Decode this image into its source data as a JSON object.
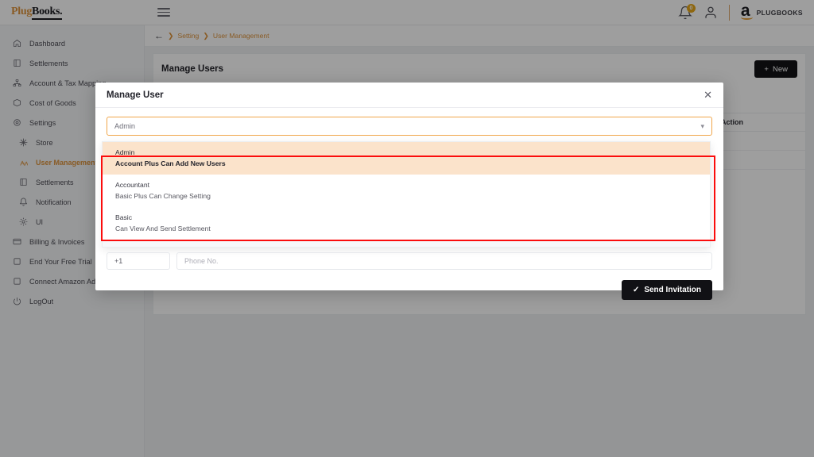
{
  "topbar": {
    "logo_part1": "Plug",
    "logo_part2": "Books.",
    "menu_icon": "hamburger-icon",
    "notification_count": "0",
    "amazon_wordmark": "a",
    "amazon_account_label": "PLUGBOOKS"
  },
  "sidebar": {
    "items": [
      {
        "label": "Dashboard",
        "icon": "home-icon",
        "level": "top",
        "active": false,
        "expandable": false
      },
      {
        "label": "Settlements",
        "icon": "book-icon",
        "level": "top",
        "active": false,
        "expandable": false
      },
      {
        "label": "Account & Tax Mapping",
        "icon": "hierarchy-icon",
        "level": "top",
        "active": false,
        "expandable": true
      },
      {
        "label": "Cost of Goods",
        "icon": "box-icon",
        "level": "top",
        "active": false,
        "expandable": false
      },
      {
        "label": "Settings",
        "icon": "gear-icon",
        "level": "top",
        "active": false,
        "expandable": false
      },
      {
        "label": "Store",
        "icon": "store-icon",
        "level": "sub",
        "active": false,
        "expandable": false
      },
      {
        "label": "User Management",
        "icon": "users-icon",
        "level": "sub",
        "active": true,
        "expandable": false
      },
      {
        "label": "Settlements",
        "icon": "book-icon",
        "level": "sub",
        "active": false,
        "expandable": false
      },
      {
        "label": "Notification",
        "icon": "bell-icon",
        "level": "sub",
        "active": false,
        "expandable": false
      },
      {
        "label": "UI",
        "icon": "sun-icon",
        "level": "sub",
        "active": false,
        "expandable": false
      },
      {
        "label": "Billing & Invoices",
        "icon": "card-icon",
        "level": "top",
        "active": false,
        "expandable": false
      },
      {
        "label": "End Your Free Trial",
        "icon": "square-icon",
        "level": "top",
        "active": false,
        "expandable": false
      },
      {
        "label": "Connect Amazon Advertisement",
        "icon": "square-icon",
        "level": "top",
        "active": false,
        "expandable": false
      },
      {
        "label": "LogOut",
        "icon": "power-icon",
        "level": "top",
        "active": false,
        "expandable": false
      }
    ]
  },
  "breadcrumb": {
    "back_icon": "arrow-left-icon",
    "items": [
      "Setting",
      "User Management"
    ]
  },
  "page": {
    "title": "Manage Users",
    "new_button": "New",
    "new_button_icon": "plus-icon",
    "search_placeholder": "",
    "table": {
      "columns": [
        "",
        "Action"
      ],
      "rows": [
        [
          "",
          ""
        ],
        [
          "",
          ""
        ]
      ]
    }
  },
  "modal": {
    "title": "Manage User",
    "close_icon": "close-icon",
    "role_select": {
      "value": "Admin",
      "chevron_icon": "chevron-down-icon",
      "options": [
        {
          "name": "Admin",
          "description": "Account Plus Can Add New Users",
          "selected": true
        },
        {
          "name": "Accountant",
          "description": "Basic Plus Can Change Setting",
          "selected": false
        },
        {
          "name": "Basic",
          "description": "Can View And Send Settlement",
          "selected": false
        }
      ]
    },
    "country_code": "+1",
    "phone_placeholder": "Phone No.",
    "submit_label": "Send Invitation",
    "submit_icon": "check-icon"
  },
  "colors": {
    "accent": "#e8912a",
    "annotation": "#fb0d0d",
    "selected_option_bg": "#fbe3cb",
    "dark_button": "#111115"
  }
}
